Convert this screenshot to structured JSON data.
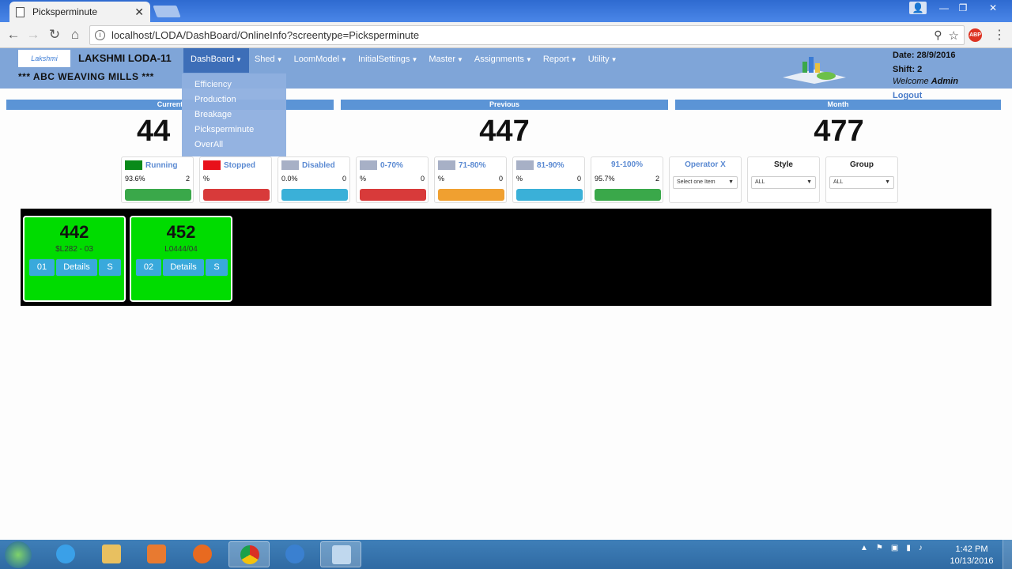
{
  "browser": {
    "tab_title": "Picksperminute",
    "url": "localhost/LODA/DashBoard/OnlineInfo?screentype=Picksperminute",
    "abp": "ABP"
  },
  "header": {
    "logo_text": "Lakshmi",
    "company": "LAKSHMI LODA-11",
    "mill": "*** ABC WEAVING MILLS ***",
    "date": "Date: 28/9/2016",
    "shift": "Shift: 2",
    "welcome_prefix": "Welcome",
    "user": "Admin",
    "logout": "Logout"
  },
  "nav": {
    "items": [
      "DashBoard",
      "Shed",
      "LoomModel",
      "InitialSettings",
      "Master",
      "Assignments",
      "Report",
      "Utility"
    ],
    "active": "DashBoard"
  },
  "dropdown": {
    "items": [
      "Efficiency",
      "Production",
      "Breakage",
      "Picksperminute",
      "OverAll"
    ]
  },
  "summary": {
    "current_label": "Current",
    "current_value": "44",
    "previous_label": "Previous",
    "previous_value": "447",
    "month_label": "Month",
    "month_value": "477"
  },
  "status": [
    {
      "label": "Running",
      "pct": "93.6%",
      "count": "2",
      "swatch": "#0a8a1a",
      "bar": "#3aa84a"
    },
    {
      "label": "Stopped",
      "pct": "%",
      "count": "",
      "swatch": "#e8101a",
      "bar": "#d83a3a"
    },
    {
      "label": "Disabled",
      "pct": "0.0%",
      "count": "0",
      "swatch": "#a7b0c6",
      "bar": "#3ab0d8"
    },
    {
      "label": "0-70%",
      "pct": "%",
      "count": "0",
      "swatch": "#a7b0c6",
      "bar": "#d83a3a"
    },
    {
      "label": "71-80%",
      "pct": "%",
      "count": "0",
      "swatch": "#a7b0c6",
      "bar": "#f0a030"
    },
    {
      "label": "81-90%",
      "pct": "%",
      "count": "0",
      "swatch": "#a7b0c6",
      "bar": "#3ab0d8"
    },
    {
      "label": "91-100%",
      "pct": "95.7%",
      "count": "2",
      "swatch": "",
      "bar": "#3aa84a"
    }
  ],
  "filters": {
    "operator": {
      "label": "Operator X",
      "value": "Select one Item"
    },
    "style": {
      "label": "Style",
      "value": "ALL"
    },
    "group": {
      "label": "Group",
      "value": "ALL"
    }
  },
  "looms": [
    {
      "value": "442",
      "code": "$L282 - 03",
      "num": "01",
      "details": "Details",
      "s": "S"
    },
    {
      "value": "452",
      "code": "L0444/04",
      "num": "02",
      "details": "Details",
      "s": "S"
    }
  ],
  "taskbar": {
    "time": "1:42 PM",
    "date": "10/13/2016"
  },
  "colors": {
    "header_bg": "#7fa5d8",
    "bar_blue": "#5b94d6",
    "loom_green": "#00dc00"
  }
}
